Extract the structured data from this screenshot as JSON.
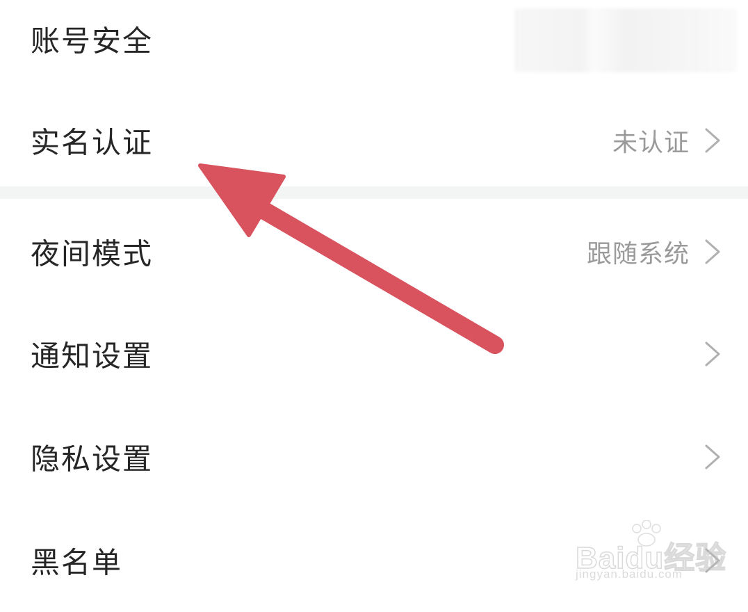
{
  "settings": {
    "items": [
      {
        "label": "账号安全",
        "value": "",
        "chevron": false
      },
      {
        "label": "实名认证",
        "value": "未认证",
        "chevron": true
      },
      {
        "label": "夜间模式",
        "value": "跟随系统",
        "chevron": true
      },
      {
        "label": "通知设置",
        "value": "",
        "chevron": true
      },
      {
        "label": "隐私设置",
        "value": "",
        "chevron": true
      },
      {
        "label": "黑名单",
        "value": "",
        "chevron": true
      }
    ]
  },
  "icons": {
    "chevron": "chevron-right-icon",
    "annotation": "red-arrow-icon",
    "watermark_paw": "paw-print-icon"
  },
  "colors": {
    "label_text": "#262626",
    "value_text": "#9a9a9a",
    "chevron": "#b0b0b0",
    "divider_band": "#f3f5f5",
    "arrow": "#d9535f"
  },
  "watermark": {
    "logo": "Baidu经验",
    "url": "jingyan.baidu.com"
  }
}
